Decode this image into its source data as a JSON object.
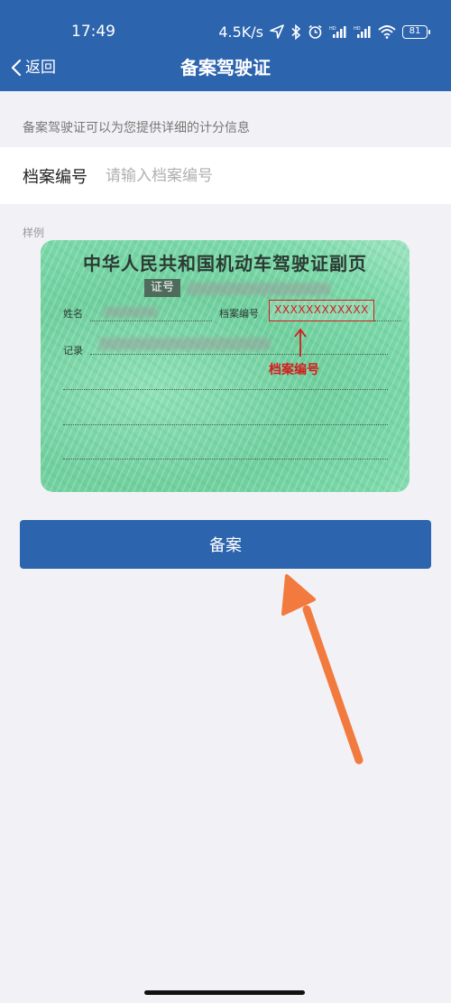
{
  "status_bar": {
    "time": "17:49",
    "net_speed": "4.5K/s",
    "battery": "81",
    "icons": [
      "location-arrow-icon",
      "bluetooth-icon",
      "alarm-icon",
      "signal-icon",
      "signal-icon",
      "wifi-icon",
      "battery-icon"
    ]
  },
  "nav": {
    "back_label": "返回",
    "title": "备案驾驶证"
  },
  "intro": "备案驾驶证可以为您提供详细的计分信息",
  "form": {
    "file_number_label": "档案编号",
    "file_number_placeholder": "请输入档案编号",
    "file_number_value": ""
  },
  "sample": {
    "label": "样例",
    "card_title": "中华人民共和国机动车驾驶证副页",
    "cert_tag": "证号",
    "name_label": "姓名",
    "file_label": "档案编号",
    "record_label": "记录",
    "file_number_example": "XXXXXXXXXXXX",
    "annotation": "档案编号"
  },
  "actions": {
    "submit_label": "备案"
  },
  "colors": {
    "primary": "#2d64ae",
    "background": "#f2f2f6",
    "annotation_red": "#d41c1c",
    "arrow_orange": "#f27a3e"
  }
}
